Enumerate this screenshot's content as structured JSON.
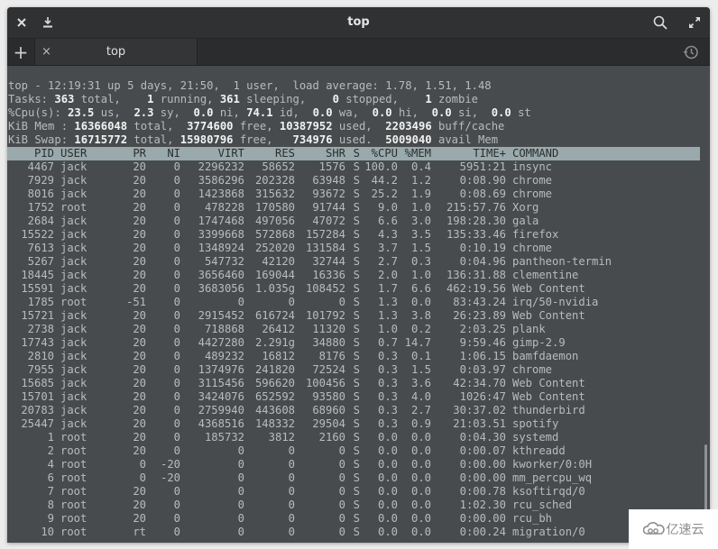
{
  "window": {
    "title": "top",
    "close_icon": "close-icon",
    "download_icon": "download-icon",
    "search_icon": "search-icon",
    "fullscreen_icon": "fullscreen-icon"
  },
  "tabs": {
    "add_label": "+",
    "items": [
      {
        "label": "top",
        "close_label": "×"
      }
    ],
    "history_icon": "history-icon"
  },
  "summary": {
    "line1": "top - 12:19:31 up 5 days, 21:50,  1 user,  load average: 1.78, 1.51, 1.48",
    "tasks": {
      "label": "Tasks:",
      "total": "363",
      "running": "1",
      "sleeping": "361",
      "stopped": "0",
      "zombie": "1"
    },
    "cpu": {
      "label": "%Cpu(s):",
      "us": "23.5",
      "sy": "2.3",
      "ni": "0.0",
      "id": "74.1",
      "wa": "0.0",
      "hi": "0.0",
      "si": "0.0",
      "st": "0.0"
    },
    "mem": {
      "label": "KiB Mem :",
      "total": "16366048",
      "free": "3774600",
      "used": "10387952",
      "buff_cache": "2203496"
    },
    "swap": {
      "label": "KiB Swap:",
      "total": "16715772",
      "free": "15980796",
      "used": "734976",
      "avail_mem": "5009040"
    }
  },
  "table": {
    "headers": [
      "PID",
      "USER",
      "PR",
      "NI",
      "VIRT",
      "RES",
      "SHR",
      "S",
      "%CPU",
      "%MEM",
      "TIME+",
      "COMMAND"
    ],
    "rows": [
      [
        "4467",
        "jack",
        "20",
        "0",
        "2296232",
        "58652",
        "1576",
        "S",
        "100.0",
        "0.4",
        "5951:21",
        "insync"
      ],
      [
        "7929",
        "jack",
        "20",
        "0",
        "3586296",
        "202328",
        "63948",
        "S",
        "44.2",
        "1.2",
        "0:08.90",
        "chrome"
      ],
      [
        "8016",
        "jack",
        "20",
        "0",
        "1423868",
        "315632",
        "93672",
        "S",
        "25.2",
        "1.9",
        "0:08.69",
        "chrome"
      ],
      [
        "1752",
        "root",
        "20",
        "0",
        "478228",
        "170580",
        "91744",
        "S",
        "9.0",
        "1.0",
        "215:57.76",
        "Xorg"
      ],
      [
        "2684",
        "jack",
        "20",
        "0",
        "1747468",
        "497056",
        "47072",
        "S",
        "6.6",
        "3.0",
        "198:28.30",
        "gala"
      ],
      [
        "15522",
        "jack",
        "20",
        "0",
        "3399668",
        "572868",
        "157284",
        "S",
        "4.3",
        "3.5",
        "135:33.46",
        "firefox"
      ],
      [
        "7613",
        "jack",
        "20",
        "0",
        "1348924",
        "252020",
        "131584",
        "S",
        "3.7",
        "1.5",
        "0:10.19",
        "chrome"
      ],
      [
        "5267",
        "jack",
        "20",
        "0",
        "547732",
        "42120",
        "32744",
        "S",
        "2.7",
        "0.3",
        "0:04.96",
        "pantheon-termin"
      ],
      [
        "18445",
        "jack",
        "20",
        "0",
        "3656460",
        "169044",
        "16336",
        "S",
        "2.0",
        "1.0",
        "136:31.88",
        "clementine"
      ],
      [
        "15591",
        "jack",
        "20",
        "0",
        "3683056",
        "1.035g",
        "108452",
        "S",
        "1.7",
        "6.6",
        "462:19.56",
        "Web Content"
      ],
      [
        "1785",
        "root",
        "-51",
        "0",
        "0",
        "0",
        "0",
        "S",
        "1.3",
        "0.0",
        "83:43.24",
        "irq/50-nvidia"
      ],
      [
        "15721",
        "jack",
        "20",
        "0",
        "2915452",
        "616724",
        "101792",
        "S",
        "1.3",
        "3.8",
        "26:23.89",
        "Web Content"
      ],
      [
        "2738",
        "jack",
        "20",
        "0",
        "718868",
        "26412",
        "11320",
        "S",
        "1.0",
        "0.2",
        "2:03.25",
        "plank"
      ],
      [
        "17743",
        "jack",
        "20",
        "0",
        "4427280",
        "2.291g",
        "34880",
        "S",
        "0.7",
        "14.7",
        "9:59.46",
        "gimp-2.9"
      ],
      [
        "2810",
        "jack",
        "20",
        "0",
        "489232",
        "16812",
        "8176",
        "S",
        "0.3",
        "0.1",
        "1:06.15",
        "bamfdaemon"
      ],
      [
        "7955",
        "jack",
        "20",
        "0",
        "1374976",
        "241820",
        "72524",
        "S",
        "0.3",
        "1.5",
        "0:03.97",
        "chrome"
      ],
      [
        "15685",
        "jack",
        "20",
        "0",
        "3115456",
        "596620",
        "100456",
        "S",
        "0.3",
        "3.6",
        "42:34.70",
        "Web Content"
      ],
      [
        "15701",
        "jack",
        "20",
        "0",
        "3424076",
        "652592",
        "93580",
        "S",
        "0.3",
        "4.0",
        "1026:47",
        "Web Content"
      ],
      [
        "20783",
        "jack",
        "20",
        "0",
        "2759940",
        "443608",
        "68960",
        "S",
        "0.3",
        "2.7",
        "30:37.02",
        "thunderbird"
      ],
      [
        "25447",
        "jack",
        "20",
        "0",
        "4368516",
        "148332",
        "29504",
        "S",
        "0.3",
        "0.9",
        "21:03.51",
        "spotify"
      ],
      [
        "1",
        "root",
        "20",
        "0",
        "185732",
        "3812",
        "2160",
        "S",
        "0.0",
        "0.0",
        "0:04.30",
        "systemd"
      ],
      [
        "2",
        "root",
        "20",
        "0",
        "0",
        "0",
        "0",
        "S",
        "0.0",
        "0.0",
        "0:00.07",
        "kthreadd"
      ],
      [
        "4",
        "root",
        "0",
        "-20",
        "0",
        "0",
        "0",
        "S",
        "0.0",
        "0.0",
        "0:00.00",
        "kworker/0:0H"
      ],
      [
        "6",
        "root",
        "0",
        "-20",
        "0",
        "0",
        "0",
        "S",
        "0.0",
        "0.0",
        "0:00.00",
        "mm_percpu_wq"
      ],
      [
        "7",
        "root",
        "20",
        "0",
        "0",
        "0",
        "0",
        "S",
        "0.0",
        "0.0",
        "0:00.78",
        "ksoftirqd/0"
      ],
      [
        "8",
        "root",
        "20",
        "0",
        "0",
        "0",
        "0",
        "S",
        "0.0",
        "0.0",
        "1:02.30",
        "rcu_sched"
      ],
      [
        "9",
        "root",
        "20",
        "0",
        "0",
        "0",
        "0",
        "S",
        "0.0",
        "0.0",
        "0:00.00",
        "rcu_bh"
      ],
      [
        "10",
        "root",
        "rt",
        "0",
        "0",
        "0",
        "0",
        "S",
        "0.0",
        "0.0",
        "0:00.24",
        "migration/0"
      ]
    ]
  },
  "watermark": {
    "text": "亿速云",
    "icon": "cloud-logo-icon"
  },
  "colors": {
    "terminal_bg": "#484b4d",
    "header_bg": "#9aa9ab",
    "text": "#b7bcbe",
    "bold_text": "#f2f2f2"
  }
}
